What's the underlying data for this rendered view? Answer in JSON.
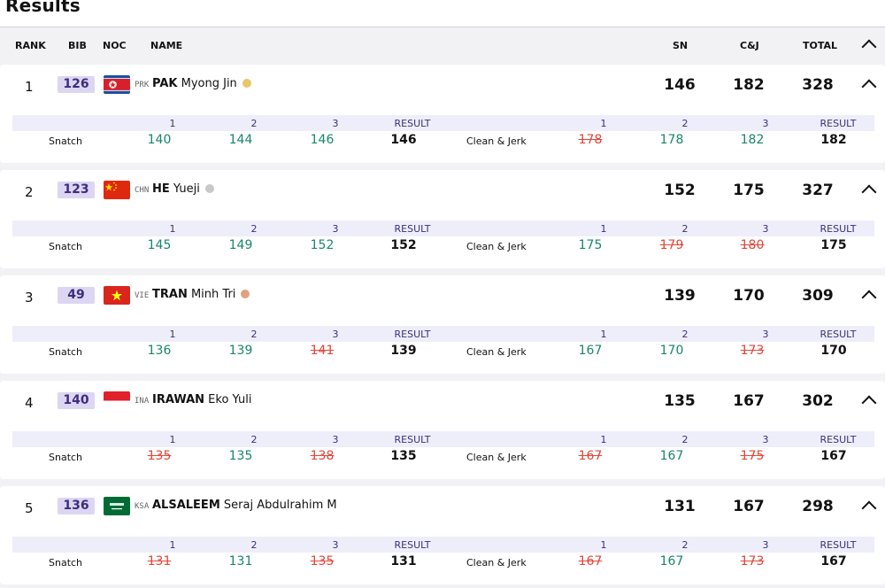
{
  "page": {
    "title": "Results"
  },
  "header": {
    "rank": "RANK",
    "bib": "BIB",
    "noc": "NOC",
    "name": "NAME",
    "sn": "SN",
    "cj": "C&J",
    "total": "TOTAL"
  },
  "labels": {
    "attempt1": "1",
    "attempt2": "2",
    "attempt3": "3",
    "result": "RESULT",
    "snatch": "Snatch",
    "clean_jerk": "Clean & Jerk"
  },
  "colors": {
    "good": "#18866b",
    "fail": "#e0473b",
    "gold": "#e8c66a",
    "silver": "#c8c8c8",
    "bronze": "#e0a27e"
  },
  "athletes": [
    {
      "rank": "1",
      "bib": "126",
      "noc": "PRK",
      "last": "PAK",
      "first": "Myong Jin",
      "medal": "gold",
      "sn": "146",
      "cj": "182",
      "total": "328",
      "snatch": [
        {
          "v": "140",
          "ok": true
        },
        {
          "v": "144",
          "ok": true
        },
        {
          "v": "146",
          "ok": true
        }
      ],
      "snatch_result": "146",
      "cjerk": [
        {
          "v": "178",
          "ok": false
        },
        {
          "v": "178",
          "ok": true
        },
        {
          "v": "182",
          "ok": true
        }
      ],
      "cjerk_result": "182"
    },
    {
      "rank": "2",
      "bib": "123",
      "noc": "CHN",
      "last": "HE",
      "first": "Yueji",
      "medal": "silver",
      "sn": "152",
      "cj": "175",
      "total": "327",
      "snatch": [
        {
          "v": "145",
          "ok": true
        },
        {
          "v": "149",
          "ok": true
        },
        {
          "v": "152",
          "ok": true
        }
      ],
      "snatch_result": "152",
      "cjerk": [
        {
          "v": "175",
          "ok": true
        },
        {
          "v": "179",
          "ok": false
        },
        {
          "v": "180",
          "ok": false
        }
      ],
      "cjerk_result": "175"
    },
    {
      "rank": "3",
      "bib": "49",
      "noc": "VIE",
      "last": "TRAN",
      "first": "Minh Tri",
      "medal": "bronze",
      "sn": "139",
      "cj": "170",
      "total": "309",
      "snatch": [
        {
          "v": "136",
          "ok": true
        },
        {
          "v": "139",
          "ok": true
        },
        {
          "v": "141",
          "ok": false
        }
      ],
      "snatch_result": "139",
      "cjerk": [
        {
          "v": "167",
          "ok": true
        },
        {
          "v": "170",
          "ok": true
        },
        {
          "v": "173",
          "ok": false
        }
      ],
      "cjerk_result": "170"
    },
    {
      "rank": "4",
      "bib": "140",
      "noc": "INA",
      "last": "IRAWAN",
      "first": "Eko Yuli",
      "medal": "",
      "sn": "135",
      "cj": "167",
      "total": "302",
      "snatch": [
        {
          "v": "135",
          "ok": false
        },
        {
          "v": "135",
          "ok": true
        },
        {
          "v": "138",
          "ok": false
        }
      ],
      "snatch_result": "135",
      "cjerk": [
        {
          "v": "167",
          "ok": false
        },
        {
          "v": "167",
          "ok": true
        },
        {
          "v": "175",
          "ok": false
        }
      ],
      "cjerk_result": "167"
    },
    {
      "rank": "5",
      "bib": "136",
      "noc": "KSA",
      "last": "ALSALEEM",
      "first": "Seraj Abdulrahim M",
      "medal": "",
      "sn": "131",
      "cj": "167",
      "total": "298",
      "snatch": [
        {
          "v": "131",
          "ok": false
        },
        {
          "v": "131",
          "ok": true
        },
        {
          "v": "135",
          "ok": false
        }
      ],
      "snatch_result": "131",
      "cjerk": [
        {
          "v": "167",
          "ok": false
        },
        {
          "v": "167",
          "ok": true
        },
        {
          "v": "173",
          "ok": false
        }
      ],
      "cjerk_result": "167"
    }
  ]
}
